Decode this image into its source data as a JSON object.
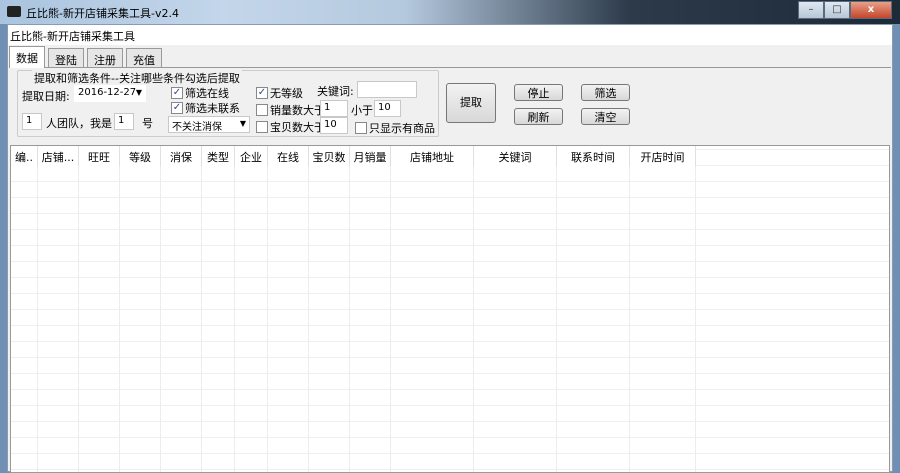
{
  "window": {
    "title": "丘比熊-新开店铺采集工具-v2.4",
    "min": "–",
    "max": "□",
    "close": "x"
  },
  "caption": "丘比熊-新开店铺采集工具",
  "tabs": [
    {
      "label": "数据",
      "active": true
    },
    {
      "label": "登陆"
    },
    {
      "label": "注册"
    },
    {
      "label": "充值"
    }
  ],
  "group": {
    "title": "提取和筛选条件--关注哪些条件勾选后提取",
    "date_label": "提取日期:",
    "date_value": "2016-12-27",
    "team_size": "1",
    "team_label": "人团队，我是",
    "my_no": "1",
    "no_label": "号",
    "xiaobao_select": "不关注消保",
    "chk_online": {
      "label": "筛选在线",
      "checked": true
    },
    "chk_uncontacted": {
      "label": "筛选未联系",
      "checked": true
    },
    "chk_nolevel": {
      "label": "无等级",
      "checked": true
    },
    "chk_sales": {
      "label": "销量数大于",
      "checked": false
    },
    "sales_min": "1",
    "less_label": "小于",
    "sales_max": "10",
    "chk_items": {
      "label": "宝贝数大于",
      "checked": false
    },
    "items_min": "10",
    "chk_hasgoods": {
      "label": "只显示有商品",
      "checked": false
    },
    "keyword_label": "关键词:",
    "keyword_value": ""
  },
  "buttons": {
    "extract": "提取",
    "stop": "停止",
    "filter": "筛选",
    "refresh": "刷新",
    "clear": "清空"
  },
  "columns": [
    "编..",
    "店铺...",
    "旺旺",
    "等级",
    "消保",
    "类型",
    "企业",
    "在线",
    "宝贝数",
    "月销量",
    "店铺地址",
    "关键词",
    "联系时间",
    "开店时间"
  ]
}
